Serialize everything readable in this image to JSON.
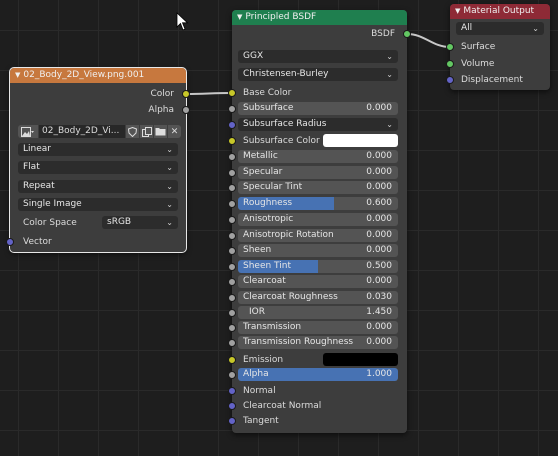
{
  "colors": {
    "texture_header": "#c7783e",
    "bsdf_header": "#1f7f4f",
    "output_header": "#8e2a36",
    "slider_fill": "#4772b3",
    "link": "#c8c8c8"
  },
  "texture_node": {
    "title": "02_Body_2D_View.png.001",
    "outputs": [
      "Color",
      "Alpha"
    ],
    "image_name": "02_Body_2D_Vi...",
    "interpolation": "Linear",
    "projection": "Flat",
    "extension": "Repeat",
    "source": "Single Image",
    "color_space_label": "Color Space",
    "color_space_value": "sRGB",
    "input_vector": "Vector",
    "icons": [
      "image-browse-icon",
      "shield-icon",
      "duplicate-icon",
      "folder-icon",
      "close-icon"
    ]
  },
  "bsdf_node": {
    "title": "Principled BSDF",
    "output": "BSDF",
    "distribution": "GGX",
    "subsurface_method": "Christensen-Burley",
    "base_color_label": "Base Color",
    "subsurface_radius_label": "Subsurface Radius",
    "subsurface_color_label": "Subsurface Color",
    "subsurface_color": "#ffffff",
    "emission_label": "Emission",
    "emission_color": "#000000",
    "params": [
      {
        "label": "Subsurface",
        "value": "0.000",
        "fill": 0
      },
      {
        "label": "Metallic",
        "value": "0.000",
        "fill": 0
      },
      {
        "label": "Specular",
        "value": "0.000",
        "fill": 0
      },
      {
        "label": "Specular Tint",
        "value": "0.000",
        "fill": 0
      },
      {
        "label": "Roughness",
        "value": "0.600",
        "fill": 0.6
      },
      {
        "label": "Anisotropic",
        "value": "0.000",
        "fill": 0
      },
      {
        "label": "Anisotropic Rotation",
        "value": "0.000",
        "fill": 0
      },
      {
        "label": "Sheen",
        "value": "0.000",
        "fill": 0
      },
      {
        "label": "Sheen Tint",
        "value": "0.500",
        "fill": 0.5
      },
      {
        "label": "Clearcoat",
        "value": "0.000",
        "fill": 0
      },
      {
        "label": "Clearcoat Roughness",
        "value": "0.030",
        "fill": 0
      },
      {
        "label": "IOR",
        "value": "1.450",
        "fill": 0
      },
      {
        "label": "Transmission",
        "value": "0.000",
        "fill": 0
      },
      {
        "label": "Transmission Roughness",
        "value": "0.000",
        "fill": 0
      },
      {
        "label": "Alpha",
        "value": "1.000",
        "fill": 1
      }
    ],
    "vector_inputs": [
      "Normal",
      "Clearcoat Normal",
      "Tangent"
    ]
  },
  "output_node": {
    "title": "Material Output",
    "target": "All",
    "inputs": [
      "Surface",
      "Volume",
      "Displacement"
    ]
  }
}
